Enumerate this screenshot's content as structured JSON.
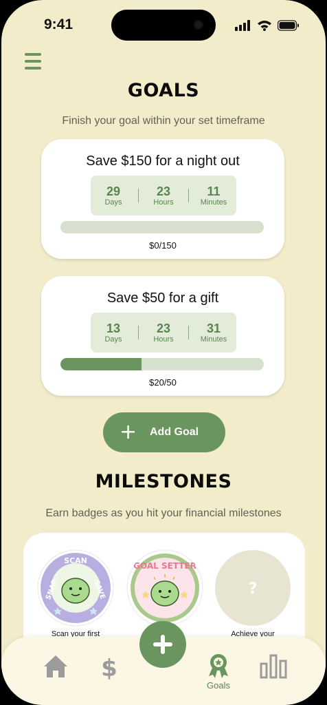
{
  "status": {
    "time": "9:41"
  },
  "goals": {
    "title": "GOALS",
    "subtitle": "Finish your goal within your set timeframe",
    "items": [
      {
        "title": "Save $150 for a night out",
        "days": "29",
        "days_label": "Days",
        "hours": "23",
        "hours_label": "Hours",
        "minutes": "11",
        "minutes_label": "Minutes",
        "progress": 0.0,
        "amount": "$0/150"
      },
      {
        "title": "Save $50 for a gift",
        "days": "13",
        "days_label": "Days",
        "hours": "23",
        "hours_label": "Hours",
        "minutes": "31",
        "minutes_label": "Minutes",
        "progress": 0.4,
        "amount": "$20/50"
      }
    ],
    "add_label": "Add Goal"
  },
  "milestones": {
    "title": "MILESTONES",
    "subtitle": "Earn badges as you hit your financial milestones",
    "badges": [
      {
        "name": "snap-scan-save",
        "text_top": "SNAP",
        "text_mid": "SCAN",
        "text_right": "SAVE",
        "label": "Scan your first"
      },
      {
        "name": "goal-setter",
        "text": "GOAL SETTER",
        "label": ""
      },
      {
        "name": "locked",
        "text": "?",
        "label": "Achieve your"
      }
    ]
  },
  "nav": {
    "items": [
      {
        "icon": "home-icon"
      },
      {
        "icon": "dollar-icon"
      },
      {
        "icon": "plus-icon"
      },
      {
        "icon": "award-icon",
        "label": "Goals",
        "active": true
      },
      {
        "icon": "bar-chart-icon"
      }
    ]
  },
  "colors": {
    "background": "#f3ecca",
    "accent": "#6b955e",
    "progress_track": "#d6e0cc",
    "timer_bg": "#e3ecd9"
  }
}
